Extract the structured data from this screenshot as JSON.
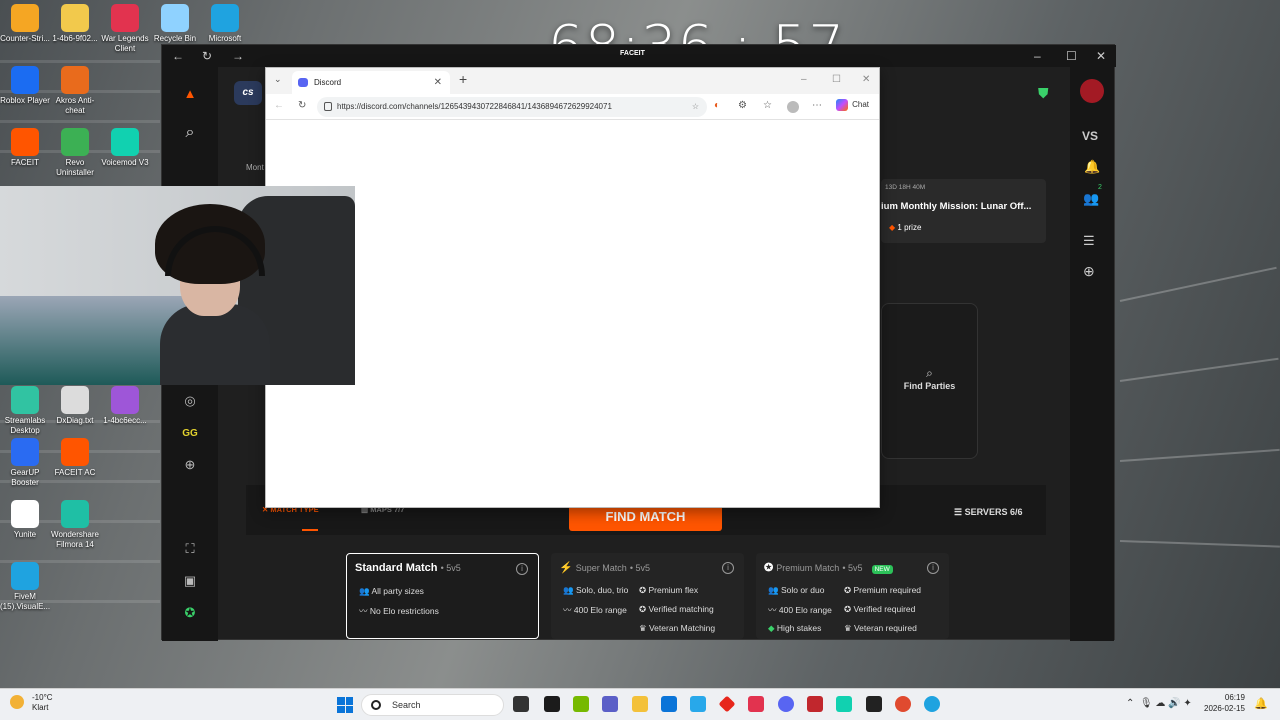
{
  "timer": "68:36 : 57",
  "timer_overlay_label": "FACEIT",
  "desktop_icons": [
    {
      "label": "Counter-Stri...",
      "color": "#f5a623"
    },
    {
      "label": "1-4b6-9f02...",
      "color": "#f2c94c"
    },
    {
      "label": "War Legends Client",
      "color": "#e2334f"
    },
    {
      "label": "Recycle Bin",
      "color": "#8fd2ff"
    },
    {
      "label": "Microsoft",
      "color": "#1fa3e0"
    },
    {
      "label": "Roblox Player",
      "color": "#1b6cf2"
    },
    {
      "label": "Akros Anti-cheat",
      "color": "#e96b1c"
    },
    {
      "label": "FACEIT",
      "color": "#ff5500"
    },
    {
      "label": "Revo Uninstaller",
      "color": "#3cb054"
    },
    {
      "label": "Voicemod V3",
      "color": "#11d1b0"
    },
    {
      "label": "Streamlabs Desktop",
      "color": "#31c3a2"
    },
    {
      "label": "DxDiag.txt",
      "color": "#dcdcdc"
    },
    {
      "label": "1-4bc6ecc...",
      "color": "#9e56d8"
    },
    {
      "label": "GearUP Booster",
      "color": "#2a6bf2"
    },
    {
      "label": "FACEIT AC",
      "color": "#ff5500"
    },
    {
      "label": "Yunite",
      "color": "#ffffff"
    },
    {
      "label": "Wondershare Filmora 14",
      "color": "#1fbfa5"
    },
    {
      "label": "FiveM (15).VisualE...",
      "color": "#1fa3e0"
    }
  ],
  "faceit": {
    "window": {
      "minimize": "–",
      "maximize": "☐",
      "close": "✕",
      "back": "←",
      "reload": "↻",
      "forward": "→"
    },
    "left_rail": {
      "logo": "▲",
      "cs_badge": "cs",
      "search": "⌕"
    },
    "mission": {
      "timer": "13D 18H 40M",
      "title": "ium Monthly Mission: Lunar Off...",
      "prize": "1 prize"
    },
    "partial_label": "Mont",
    "right_rail": {
      "vs": "VS",
      "badge_count": "2"
    },
    "find_parties": "Find Parties",
    "tabs": {
      "match_type": "MATCH TYPE",
      "maps": "MAPS 7/7"
    },
    "find_match": "FIND MATCH",
    "servers": "SERVERS 6/6",
    "cards": [
      {
        "title": "Standard Match",
        "mode": "• 5v5",
        "features": [
          "All party sizes",
          "No Elo restrictions"
        ],
        "new": ""
      },
      {
        "title": "Super Match",
        "mode": "• 5v5",
        "features": [
          "Solo, duo, trio",
          "Premium flex",
          "400 Elo range",
          "Verified matching",
          "Veteran Matching"
        ],
        "new": ""
      },
      {
        "title": "Premium Match",
        "mode": "• 5v5",
        "features": [
          "Solo or duo",
          "Premium required",
          "400 Elo range",
          "Verified required",
          "High stakes",
          "Veteran required"
        ],
        "new": "NEW"
      }
    ]
  },
  "browser": {
    "tab_title": "Discord",
    "url": "https://discord.com/channels/1265439430722846841/1436894672629924071",
    "chat_label": "Chat",
    "new_tab": "+",
    "tab_close": "✕"
  },
  "taskbar": {
    "weather_temp": "-10°C",
    "weather_desc": "Klart",
    "search_placeholder": "Search",
    "time": "06:19",
    "date": "2026-02-15"
  }
}
